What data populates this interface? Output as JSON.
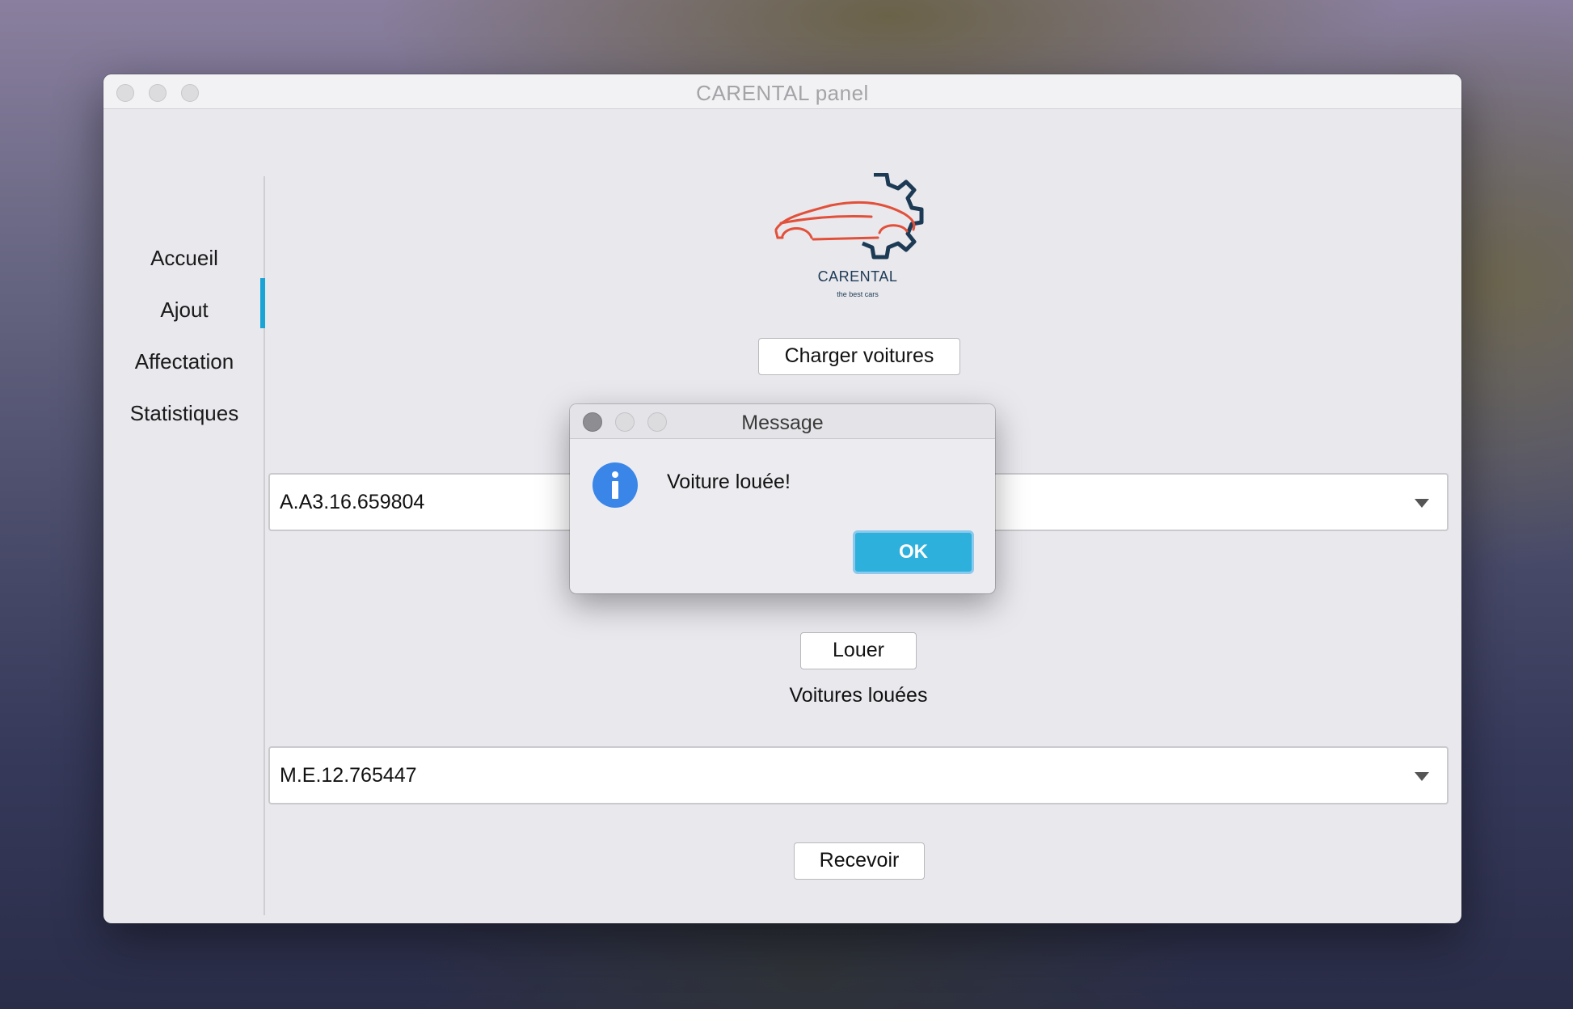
{
  "window": {
    "title": "CARENTAL panel"
  },
  "sidebar": {
    "items": [
      {
        "label": "Accueil",
        "active": false
      },
      {
        "label": "Ajout",
        "active": false
      },
      {
        "label": "Affectation",
        "active": true
      },
      {
        "label": "Statistiques",
        "active": false
      }
    ],
    "accent_color": "#1aa4d6"
  },
  "logo": {
    "name": "CARENTAL",
    "tagline": "the best cars"
  },
  "main": {
    "load_button_label": "Charger voitures",
    "available_combo_value": "A.A3.16.659804",
    "rent_button_label": "Louer",
    "rented_section_label": "Voitures louées",
    "rented_combo_value": "M.E.12.765447",
    "receive_button_label": "Recevoir"
  },
  "dialog": {
    "title": "Message",
    "icon": "info-icon",
    "message": "Voiture louée!",
    "ok_label": "OK",
    "ok_color": "#2db0dc"
  }
}
